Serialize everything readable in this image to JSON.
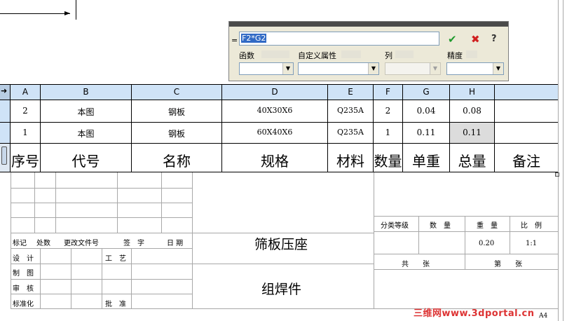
{
  "formula": {
    "equals": "=",
    "input_value": "F2*G2",
    "labels": {
      "function": "函数",
      "custom_property": "自定义属性",
      "column": "列",
      "precision": "精度"
    }
  },
  "columns": [
    "A",
    "B",
    "C",
    "D",
    "E",
    "F",
    "G",
    "H"
  ],
  "rows": [
    [
      "2",
      "本图",
      "钢板",
      "40X30X6",
      "Q235A",
      "2",
      "0.04",
      "0.08"
    ],
    [
      "1",
      "本图",
      "钢板",
      "60X40X6",
      "Q235A",
      "1",
      "0.11",
      "0.11"
    ]
  ],
  "header": [
    "序号",
    "代号",
    "名称",
    "规格",
    "材料",
    "数量",
    "单重",
    "总量",
    "备注"
  ],
  "title_block": {
    "mark": "标记",
    "count": "处数",
    "change_doc": "更改文件号",
    "signature": "签　字",
    "date": "日 期",
    "design": "设　计",
    "process": "工　艺",
    "drawing": "制　图",
    "check": "审　核",
    "standard": "标准化",
    "approve": "批　准",
    "part_name": "筛板压座",
    "part_type": "组焊件",
    "classification": "分类等级",
    "quantity": "数　量",
    "weight": "重　量",
    "scale": "比　例",
    "weight_value": "0.20",
    "scale_value": "1:1",
    "total_sheets": "共　　张",
    "sheet_no": "第　　张",
    "paper_size": "A4"
  },
  "watermark": "三维网www.3dportal.cn"
}
